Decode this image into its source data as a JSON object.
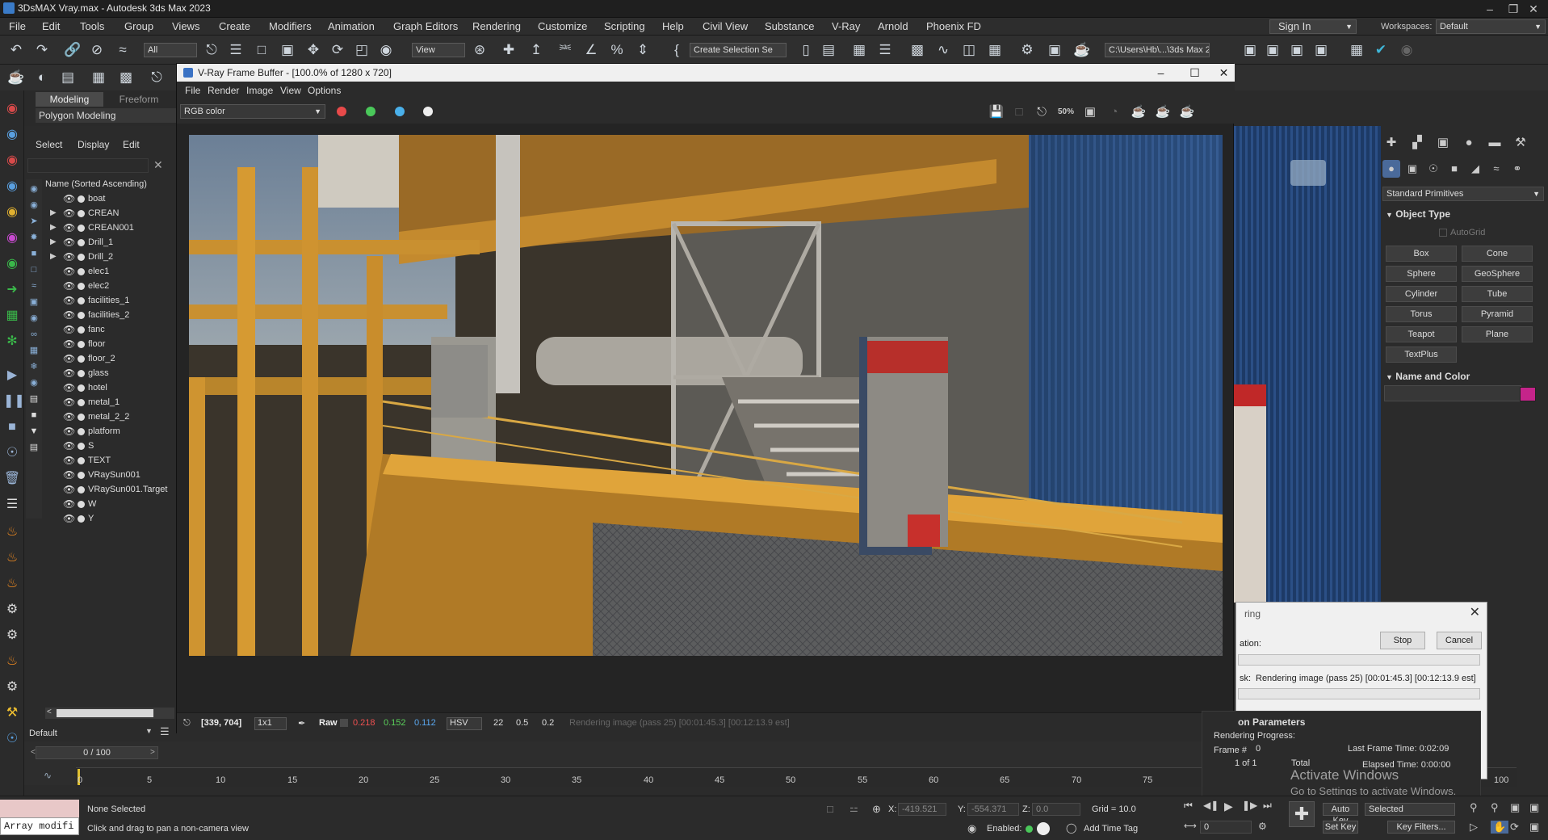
{
  "window": {
    "title": "3DsMAX Vray.max - Autodesk 3ds Max 2023"
  },
  "menu": [
    "File",
    "Edit",
    "Tools",
    "Group",
    "Views",
    "Create",
    "Modifiers",
    "Animation",
    "Graph Editors",
    "Rendering",
    "Customize",
    "Scripting",
    "Help",
    "Civil View",
    "Substance",
    "V-Ray",
    "Arnold",
    "Phoenix FD"
  ],
  "account": {
    "sign_in": "Sign In",
    "workspaces_label": "Workspaces:",
    "workspace": "Default"
  },
  "toolbar": {
    "filter": "All",
    "ref_coord": "View",
    "selection_set": "Create Selection Se",
    "project_path": "C:\\Users\\Hb\\...\\3ds Max 202"
  },
  "ribbon": {
    "tab_modeling": "Modeling",
    "tab_freeform": "Freeform",
    "sub": "Polygon Modeling"
  },
  "explorer": {
    "menu": [
      "Select",
      "Display",
      "Edit"
    ],
    "header": "Name (Sorted Ascending)",
    "items": [
      {
        "name": "boat",
        "expand": false
      },
      {
        "name": "CREAN",
        "expand": true
      },
      {
        "name": "CREAN001",
        "expand": true
      },
      {
        "name": "Drill_1",
        "expand": true
      },
      {
        "name": "Drill_2",
        "expand": true
      },
      {
        "name": "elec1",
        "expand": false
      },
      {
        "name": "elec2",
        "expand": false
      },
      {
        "name": "facilities_1",
        "expand": false
      },
      {
        "name": "facilities_2",
        "expand": false
      },
      {
        "name": "fanc",
        "expand": false
      },
      {
        "name": "floor",
        "expand": false
      },
      {
        "name": "floor_2",
        "expand": false
      },
      {
        "name": "glass",
        "expand": false
      },
      {
        "name": "hotel",
        "expand": false
      },
      {
        "name": "metal_1",
        "expand": false
      },
      {
        "name": "metal_2_2",
        "expand": false
      },
      {
        "name": "platform",
        "expand": false
      },
      {
        "name": "S",
        "expand": false
      },
      {
        "name": "TEXT",
        "expand": false
      },
      {
        "name": "VRaySun001",
        "expand": false
      },
      {
        "name": "VRaySun001.Target",
        "expand": false
      },
      {
        "name": "W",
        "expand": false
      },
      {
        "name": "Y",
        "expand": false
      }
    ],
    "layer": "Default"
  },
  "vfb": {
    "title": "V-Ray Frame Buffer - [100.0% of 1280 x 720]",
    "menu": [
      "File",
      "Render",
      "Image",
      "View",
      "Options"
    ],
    "channel": "RGB color",
    "status": {
      "coords": "[339, 704]",
      "zoom": "1x1",
      "raw": "Raw",
      "r": "0.218",
      "g": "0.152",
      "b": "0.112",
      "mode": "HSV",
      "h": "22",
      "s": "0.5",
      "v": "0.2",
      "msg": "Rendering image (pass 25) [00:01:45.3] [00:12:13.9 est]"
    },
    "tool_label": "50%"
  },
  "command_panel": {
    "category": "Standard Primitives",
    "object_type": "Object Type",
    "autogrid": "AutoGrid",
    "buttons": [
      "Box",
      "Cone",
      "Sphere",
      "GeoSphere",
      "Cylinder",
      "Tube",
      "Torus",
      "Pyramid",
      "Teapot",
      "Plane",
      "TextPlus"
    ],
    "name_color": "Name and Color",
    "color": "#c5248a"
  },
  "progress": {
    "title": "ring",
    "operation": "ation:",
    "stop": "Stop",
    "cancel": "Cancel",
    "task_label": "sk:",
    "task": "Rendering image (pass 25) [00:01:45.3] [00:12:13.9 est]"
  },
  "common_params": {
    "header": "on Parameters",
    "progress_label": "Rendering Progress:",
    "frame_label": "Frame #",
    "frame": "0",
    "of": "1 of 1",
    "total": "Total",
    "last_frame": "Last Frame Time: 0:02:09",
    "elapsed": "Elapsed Time: 0:00:00"
  },
  "activation": {
    "line1": "Activate Windows",
    "line2": "Go to Settings to activate Windows."
  },
  "timeline": {
    "slider": "0 / 100",
    "ticks": [
      "0",
      "5",
      "10",
      "15",
      "20",
      "25",
      "30",
      "35",
      "40",
      "45",
      "50",
      "55",
      "60",
      "65",
      "70",
      "75",
      "100"
    ]
  },
  "status": {
    "selection": "None Selected",
    "prompt": "Click and drag to pan a non-camera view",
    "x_label": "X:",
    "x": "-419.521",
    "y_label": "Y:",
    "y": "-554.371",
    "z_label": "Z:",
    "z": "0.0",
    "grid": "Grid = 10.0",
    "enabled": "Enabled:",
    "add_time_tag": "Add Time Tag",
    "auto_key": "Auto Key",
    "selected": "Selected",
    "set_key": "Set Key",
    "key_filters": "Key Filters...",
    "frame": "0",
    "maxscript": "Array modifi"
  }
}
